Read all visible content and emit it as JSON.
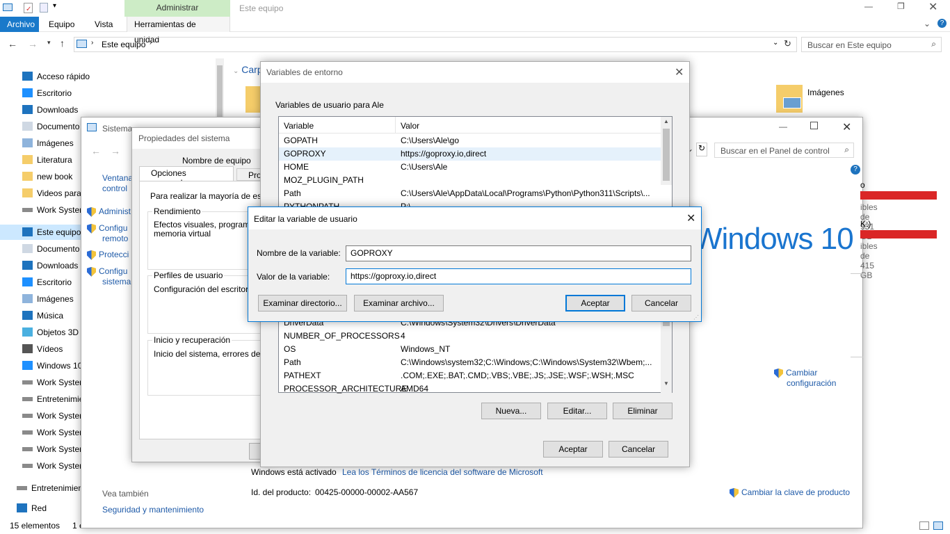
{
  "explorer": {
    "title": "Este equipo",
    "context_tab": "Administrar",
    "tabs": [
      "Archivo",
      "Equipo",
      "Vista",
      "Herramientas de unidad"
    ],
    "address": "Este equipo",
    "search_placeholder": "Buscar en Este equipo",
    "section_partial": "Carp",
    "images_folder": "Imágenes",
    "nav": [
      {
        "label": "Acceso rápido",
        "icon": "star-icon"
      },
      {
        "label": "Escritorio",
        "icon": "desktop-icon"
      },
      {
        "label": "Downloads",
        "icon": "download-icon"
      },
      {
        "label": "Documento",
        "icon": "document-icon"
      },
      {
        "label": "Imágenes",
        "icon": "pictures-icon"
      },
      {
        "label": "Literatura",
        "icon": "folder-icon"
      },
      {
        "label": "new book",
        "icon": "folder-icon"
      },
      {
        "label": "Videos para",
        "icon": "folder-icon"
      },
      {
        "label": "Work Systen",
        "icon": "drive-icon"
      },
      {
        "label": "Este equipo",
        "icon": "computer-icon"
      },
      {
        "label": "Documento",
        "icon": "document-icon"
      },
      {
        "label": "Downloads",
        "icon": "download-icon"
      },
      {
        "label": "Escritorio",
        "icon": "desktop-icon"
      },
      {
        "label": "Imágenes",
        "icon": "pictures-icon"
      },
      {
        "label": "Música",
        "icon": "music-icon"
      },
      {
        "label": "Objetos 3D",
        "icon": "cube-icon"
      },
      {
        "label": "Vídeos",
        "icon": "video-icon"
      },
      {
        "label": "Windows 10",
        "icon": "windows-drive-icon"
      },
      {
        "label": "Work Systen",
        "icon": "drive-icon"
      },
      {
        "label": "Entretenimie",
        "icon": "drive-icon"
      },
      {
        "label": "Work Systen",
        "icon": "drive-icon"
      },
      {
        "label": "Work Systen",
        "icon": "drive-icon"
      },
      {
        "label": "Work Systen",
        "icon": "drive-icon"
      },
      {
        "label": "Work Systen",
        "icon": "drive-icon"
      },
      {
        "label": "Entretenimien",
        "icon": "drive-icon"
      },
      {
        "label": "Red",
        "icon": "network-icon"
      }
    ],
    "status_count": "15 elementos",
    "status_selected": "1 e"
  },
  "system": {
    "title": "Sistema",
    "search_placeholder": "Buscar en el Panel de control",
    "left_links": [
      "Ventana",
      "control",
      "Administ",
      "Configu",
      "remoto",
      "Protecci",
      "Configu",
      "sistema"
    ],
    "windows_logo": "Windows 10",
    "drive_f": "o (F:)",
    "drive_f_free": "ibles de 931 GB",
    "drive_k": "K:)",
    "drive_k_free": "ibles de 415 GB",
    "change_config": "Cambiar",
    "change_config2": "configuración",
    "activated": "Windows está activado",
    "license_link": "Lea los Términos de licencia del software de Microsoft",
    "product_id_label": "Id. del producto:",
    "product_id": "00425-00000-00002-AA567",
    "change_key": "Cambiar la clave de producto",
    "see_also": "Vea también",
    "security": "Seguridad y mantenimiento"
  },
  "props": {
    "title": "Propiedades del sistema",
    "tab_name": "Nombre de equipo",
    "tab_advanced": "Opciones avanzadas",
    "tab_prot": "Prot",
    "intro": "Para realizar la mayoría de estos c",
    "perf_label": "Rendimiento",
    "perf_text1": "Efectos visuales, programaci",
    "perf_text2": "memoria virtual",
    "profiles_label": "Perfiles de usuario",
    "profiles_text": "Configuración del escritorio c",
    "startup_label": "Inicio y recuperación",
    "startup_text": "Inicio del sistema, errores del sist"
  },
  "env": {
    "title": "Variables de entorno",
    "user_group": "Variables de usuario para Ale",
    "col_var": "Variable",
    "col_val": "Valor",
    "user_vars": [
      {
        "name": "GOPATH",
        "value": "C:\\Users\\Ale\\go"
      },
      {
        "name": "GOPROXY",
        "value": "https://goproxy.io,direct"
      },
      {
        "name": "HOME",
        "value": "C:\\Users\\Ale"
      },
      {
        "name": "MOZ_PLUGIN_PATH",
        "value": ""
      },
      {
        "name": "Path",
        "value": "C:\\Users\\Ale\\AppData\\Local\\Programs\\Python\\Python311\\Scripts\\..."
      },
      {
        "name": "PYTHONPATH",
        "value": "P:\\"
      }
    ],
    "sys_vars": [
      {
        "name": "DriverData",
        "value": "C:\\Windows\\System32\\Drivers\\DriverData"
      },
      {
        "name": "NUMBER_OF_PROCESSORS",
        "value": "4"
      },
      {
        "name": "OS",
        "value": "Windows_NT"
      },
      {
        "name": "Path",
        "value": "C:\\Windows\\system32;C:\\Windows;C:\\Windows\\System32\\Wbem;..."
      },
      {
        "name": "PATHEXT",
        "value": ".COM;.EXE;.BAT;.CMD;.VBS;.VBE;.JS;.JSE;.WSF;.WSH;.MSC"
      },
      {
        "name": "PROCESSOR_ARCHITECTURE",
        "value": "AMD64"
      }
    ],
    "new_btn": "Nueva...",
    "edit_btn": "Editar...",
    "delete_btn": "Eliminar",
    "ok_btn": "Aceptar",
    "cancel_btn": "Cancelar"
  },
  "edit": {
    "title": "Editar la variable de usuario",
    "name_label": "Nombre de la variable:",
    "name_value": "GOPROXY",
    "value_label": "Valor de la variable:",
    "value_value": "https://goproxy.io,direct",
    "browse_dir": "Examinar directorio...",
    "browse_file": "Examinar archivo...",
    "ok": "Aceptar",
    "cancel": "Cancelar"
  },
  "colors": {
    "accent": "#0078d7",
    "drive_bar": "#da2626",
    "context_tab_bg": "#c6efce"
  }
}
